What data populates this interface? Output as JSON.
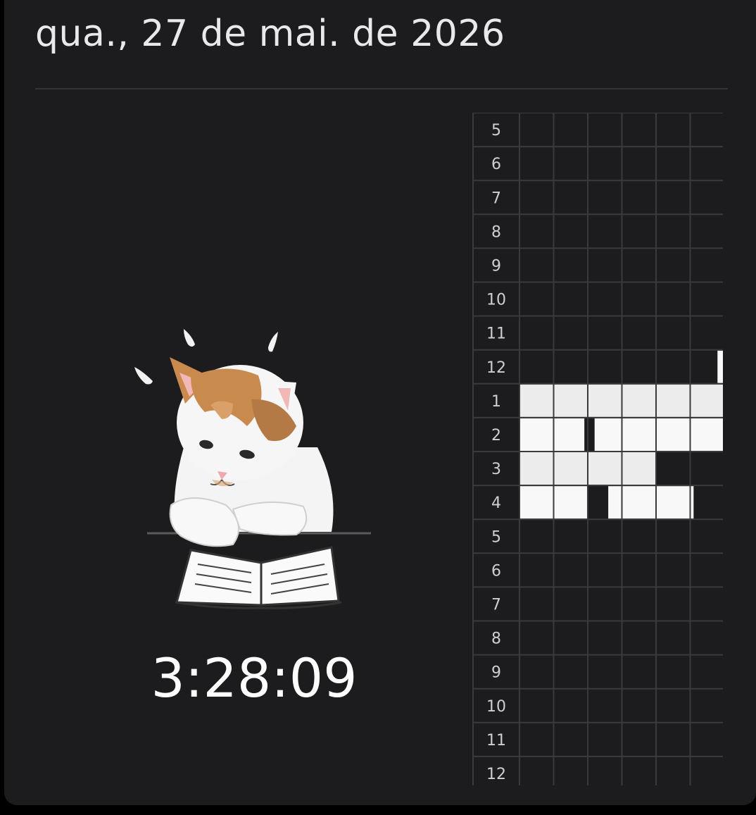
{
  "header": {
    "date": "qua., 27 de mai. de 2026"
  },
  "timer": {
    "elapsed": "3:28:09"
  },
  "illustration": {
    "icon": "cat-reading-book-icon"
  },
  "hour_grid": {
    "hours": [
      "5",
      "6",
      "7",
      "8",
      "9",
      "10",
      "11",
      "12",
      "1",
      "2",
      "3",
      "4",
      "5",
      "6",
      "7",
      "8",
      "9",
      "10",
      "11",
      "12"
    ],
    "minutes_per_hour": 60,
    "columns": 6,
    "colors": {
      "background": "#1c1c1e",
      "grid_line": "#3a3a3d",
      "label_cell": "#1c1c1e",
      "active_light": "#ececec",
      "active_white": "#f8f8f8",
      "gap": "#1c1c1e"
    },
    "active_minutes": [
      {
        "hour_index": 7,
        "from": 58,
        "to": 60
      },
      {
        "hour_index": 8,
        "from": 0,
        "to": 60
      },
      {
        "hour_index": 9,
        "from": 0,
        "to": 19
      },
      {
        "hour_index": 9,
        "from": 22,
        "to": 60
      },
      {
        "hour_index": 10,
        "from": 0,
        "to": 40
      },
      {
        "hour_index": 11,
        "from": 0,
        "to": 20
      },
      {
        "hour_index": 11,
        "from": 26,
        "to": 51
      }
    ]
  }
}
